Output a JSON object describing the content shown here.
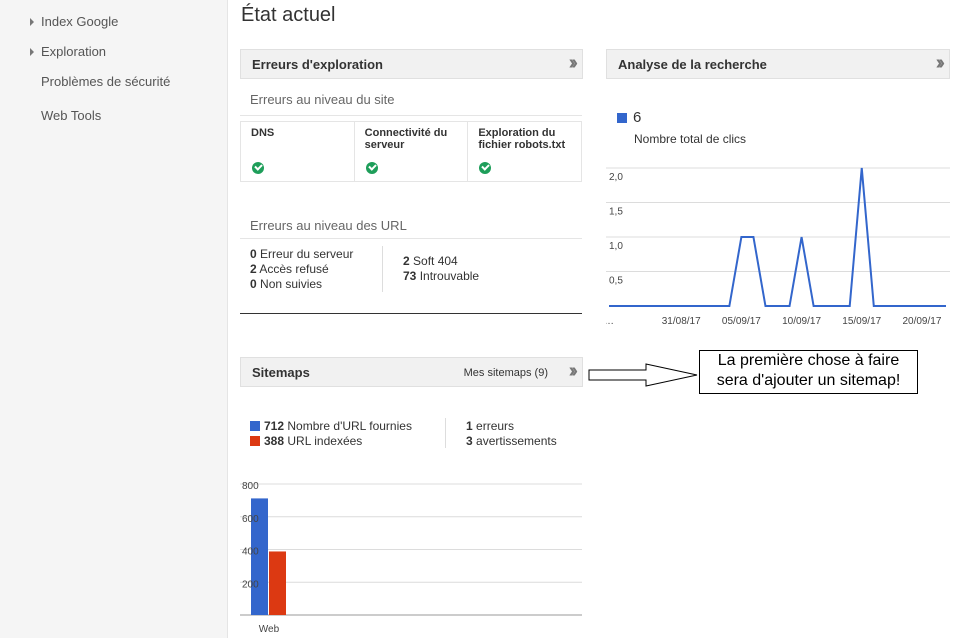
{
  "sidebar": {
    "items": [
      {
        "label": "Index Google",
        "expandable": true
      },
      {
        "label": "Exploration",
        "expandable": true
      },
      {
        "label": "Problèmes de sécurité",
        "expandable": false
      },
      {
        "label": "Web Tools",
        "expandable": false
      }
    ]
  },
  "page_title": "État actuel",
  "crawl_errors": {
    "title": "Erreurs d'exploration",
    "site_level_heading": "Erreurs au niveau du site",
    "site_checks": [
      {
        "label": "DNS",
        "status": "ok"
      },
      {
        "label": "Connectivité du serveur",
        "status": "ok"
      },
      {
        "label": "Exploration du fichier robots.txt",
        "status": "ok"
      }
    ],
    "url_level_heading": "Erreurs au niveau des URL",
    "url_errors_left": [
      {
        "count": "0",
        "label": "Erreur du serveur"
      },
      {
        "count": "2",
        "label": "Accès refusé"
      },
      {
        "count": "0",
        "label": "Non suivies"
      }
    ],
    "url_errors_right": [
      {
        "count": "2",
        "label": "Soft 404"
      },
      {
        "count": "73",
        "label": "Introuvable"
      }
    ]
  },
  "search_analytics": {
    "title": "Analyse de la recherche",
    "total": "6",
    "total_label": "Nombre total de clics",
    "color": "#3366cc"
  },
  "sitemaps": {
    "title": "Sitemaps",
    "link_label": "Mes sitemaps (9)",
    "submitted_count": "712",
    "submitted_label": "Nombre d'URL fournies",
    "indexed_count": "388",
    "indexed_label": "URL indexées",
    "errors_count": "1",
    "errors_label": "erreurs",
    "warnings_count": "3",
    "warnings_label": "avertissements",
    "submitted_color": "#3366cc",
    "indexed_color": "#dc3912"
  },
  "callout": {
    "line1": "La première chose à faire",
    "line2": "sera d'ajouter un sitemap!"
  },
  "chart_data": [
    {
      "type": "line",
      "x_tick_labels": [
        "…",
        "31/08/17",
        "05/09/17",
        "10/09/17",
        "15/09/17",
        "20/09/17"
      ],
      "y_tick_labels": [
        "2,0",
        "1,5",
        "1,0",
        "0,5"
      ],
      "ylim": [
        0,
        2
      ],
      "series": [
        {
          "color": "#3366cc",
          "x": [
            "25/08/17",
            "26/08/17",
            "27/08/17",
            "28/08/17",
            "29/08/17",
            "30/08/17",
            "31/08/17",
            "01/09/17",
            "02/09/17",
            "03/09/17",
            "04/09/17",
            "05/09/17",
            "06/09/17",
            "07/09/17",
            "08/09/17",
            "09/09/17",
            "10/09/17",
            "11/09/17",
            "12/09/17",
            "13/09/17",
            "14/09/17",
            "15/09/17",
            "16/09/17",
            "17/09/17",
            "18/09/17",
            "19/09/17",
            "20/09/17",
            "21/09/17",
            "22/09/17"
          ],
          "values": [
            0,
            0,
            0,
            0,
            0,
            0,
            0,
            0,
            0,
            0,
            0,
            1,
            1,
            0,
            0,
            0,
            1,
            0,
            0,
            0,
            0,
            2,
            0,
            0,
            0,
            0,
            0,
            0,
            0
          ]
        }
      ]
    },
    {
      "type": "bar",
      "categories": [
        "Web"
      ],
      "y_tick_labels": [
        "800",
        "600",
        "400",
        "200"
      ],
      "ylim": [
        0,
        800
      ],
      "series": [
        {
          "name": "Nombre d'URL fournies",
          "color": "#3366cc",
          "values": [
            712
          ]
        },
        {
          "name": "URL indexées",
          "color": "#dc3912",
          "values": [
            388
          ]
        }
      ]
    }
  ]
}
